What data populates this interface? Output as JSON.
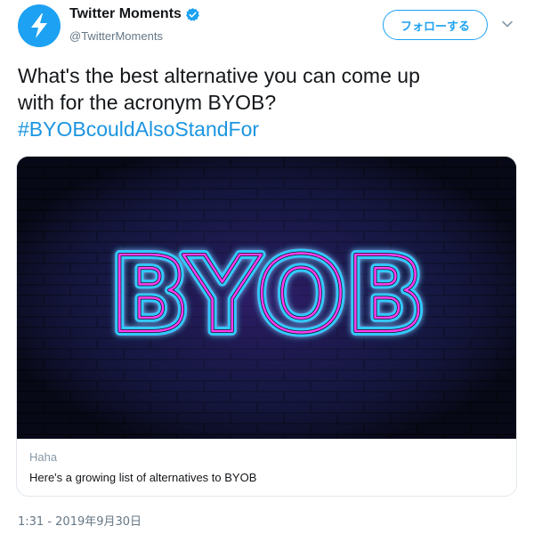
{
  "user": {
    "display_name": "Twitter Moments",
    "handle": "@TwitterMoments",
    "verified_icon": "verified-badge-icon",
    "avatar_icon": "lightning-bolt-icon"
  },
  "follow_button": {
    "label": "フォローする"
  },
  "more_menu": {
    "icon": "chevron-down-icon"
  },
  "tweet": {
    "line1": "What's the best alternative you can come up",
    "line2": "with for the acronym BYOB?",
    "hashtag": "#BYOBcouldAlsoStandFor"
  },
  "card": {
    "image_text": "BYOB",
    "caption": "Haha",
    "description": "Here's a growing list of alternatives to BYOB"
  },
  "timestamp": "1:31 - 2019年9月30日",
  "colors": {
    "accent": "#1da1f2",
    "hashtag": "#1b95e0",
    "neon_blue": "#33c9ff",
    "neon_pink": "#ff3df0"
  }
}
